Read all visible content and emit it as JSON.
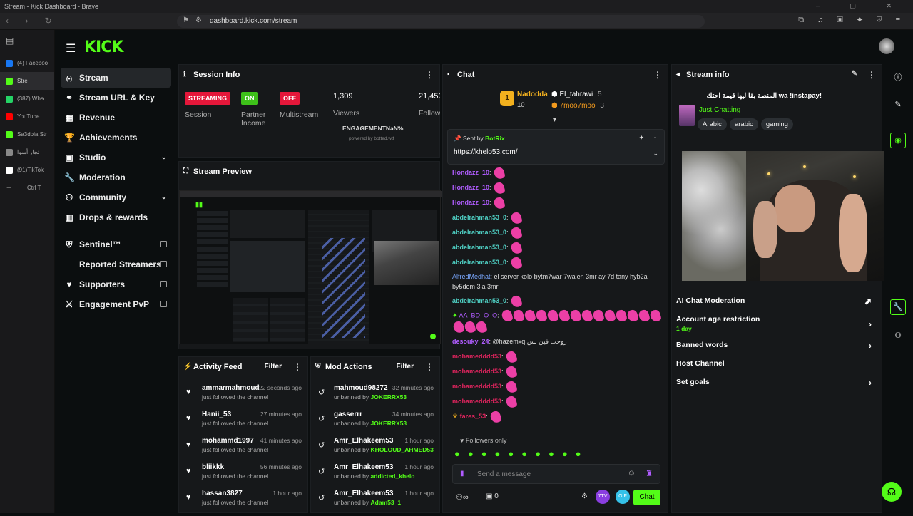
{
  "browser": {
    "window_title": "Stream - Kick Dashboard - Brave",
    "url": "dashboard.kick.com/stream",
    "tabs": [
      {
        "label": "(4) Faceboo",
        "color": "#1877f2"
      },
      {
        "label": "Stre",
        "color": "#53fc18"
      },
      {
        "label": "(387) Wha",
        "color": "#25d366"
      },
      {
        "label": "YouTube",
        "color": "#ff0000"
      },
      {
        "label": "Sa3dola Str",
        "color": "#53fc18"
      },
      {
        "label": "تجار أسوا",
        "color": "#888888"
      },
      {
        "label": "(91)TikTok",
        "color": "#ffffff"
      }
    ],
    "new_tab_shortcut": "Ctrl T"
  },
  "brand": {
    "logo": "KICK",
    "accent": "#53fc18"
  },
  "sidebar": {
    "items": [
      {
        "label": "Stream",
        "icon": "broadcast-icon"
      },
      {
        "label": "Stream URL & Key",
        "icon": "link-icon"
      },
      {
        "label": "Revenue",
        "icon": "revenue-icon"
      },
      {
        "label": "Achievements",
        "icon": "trophy-icon"
      },
      {
        "label": "Studio",
        "icon": "studio-icon"
      },
      {
        "label": "Moderation",
        "icon": "wrench-icon"
      },
      {
        "label": "Community",
        "icon": "people-icon"
      },
      {
        "label": "Drops & rewards",
        "icon": "gift-icon"
      }
    ],
    "external": [
      {
        "label": "Sentinel™"
      },
      {
        "label": "Reported Streamers"
      },
      {
        "label": "Supporters"
      },
      {
        "label": "Engagement PvP"
      }
    ]
  },
  "session_info": {
    "title": "Session Info",
    "stats": [
      {
        "badge": "STREAMING",
        "label": "Session"
      },
      {
        "badge": "ON",
        "label": "Partner Income"
      },
      {
        "badge": "OFF",
        "label": "Multistream"
      },
      {
        "value": "1,309",
        "label": "Viewers"
      },
      {
        "value": "21,450",
        "label": "Follow"
      }
    ],
    "engagement": "ENGAGEMENTNaN%",
    "powered": "powered by botted.wtf"
  },
  "stream_preview": {
    "title": "Stream Preview"
  },
  "activity_feed": {
    "title": "Activity Feed",
    "filter": "Filter",
    "items": [
      {
        "user": "ammarmahmoud",
        "time": "22 seconds ago",
        "text": "just followed the channel"
      },
      {
        "user": "Hanii_53",
        "time": "27 minutes ago",
        "text": "just followed the channel"
      },
      {
        "user": "mohammd1997",
        "time": "41 minutes ago",
        "text": "just followed the channel"
      },
      {
        "user": "bliikkk",
        "time": "56 minutes ago",
        "text": "just followed the channel"
      },
      {
        "user": "hassan3827",
        "time": "1 hour ago",
        "text": "just followed the channel"
      }
    ]
  },
  "mod_actions": {
    "title": "Mod Actions",
    "filter": "Filter",
    "items": [
      {
        "user": "mahmoud98272",
        "time": "32 minutes ago",
        "prefix": "unbanned by",
        "by": "JOKERRX53"
      },
      {
        "user": "gasserrr",
        "time": "34 minutes ago",
        "prefix": "unbanned by",
        "by": "JOKERRX53"
      },
      {
        "user": "Amr_Elhakeem53",
        "time": "1 hour ago",
        "prefix": "unbanned by",
        "by": "KHOLOUD_AHMED53"
      },
      {
        "user": "Amr_Elhakeem53",
        "time": "1 hour ago",
        "prefix": "unbanned by",
        "by": "addicted_khelo"
      },
      {
        "user": "Amr_Elhakeem53",
        "time": "1 hour ago",
        "prefix": "unbanned by",
        "by": "Adam53_1"
      }
    ]
  },
  "chat": {
    "title": "Chat",
    "leaderboard": [
      {
        "name": "Nadodda",
        "count": "10"
      },
      {
        "name": "El_tahrawi",
        "count": "5"
      },
      {
        "name": "7moo7moo",
        "count": "3"
      }
    ],
    "pinned": {
      "sent_by": "Sent by",
      "bot": "BotRix",
      "link": "https://khelo53.com/"
    },
    "messages": [
      {
        "user": "Hondazz_10",
        "color": "#b05cff",
        "text": "",
        "emotes": 1
      },
      {
        "user": "Hondazz_10",
        "color": "#b05cff",
        "text": "",
        "emotes": 1
      },
      {
        "user": "Hondazz_10",
        "color": "#b05cff",
        "text": "",
        "emotes": 1
      },
      {
        "user": "abdelrahman53_0",
        "color": "#4fd1c5",
        "text": "",
        "emotes": 1
      },
      {
        "user": "abdelrahman53_0",
        "color": "#4fd1c5",
        "text": "",
        "emotes": 1
      },
      {
        "user": "abdelrahman53_0",
        "color": "#4fd1c5",
        "text": "",
        "emotes": 1
      },
      {
        "user": "abdelrahman53_0",
        "color": "#4fd1c5",
        "text": "",
        "emotes": 1
      }
    ],
    "long_message": {
      "user": "AlfredMedhat",
      "color": "#7aa8ff",
      "text": "el server kolo bytm7war 7walen 3mr ay 7d tany hyb2a by5dem 3la 3mr"
    },
    "messages2": [
      {
        "user": "abdelrahman53_0",
        "color": "#4fd1c5",
        "text": "",
        "emotes": 1
      }
    ],
    "spam": {
      "user": "AA_BD_O_O",
      "color": "#b05cff"
    },
    "desouky": {
      "user": "desouky_24",
      "color": "#b05cff",
      "text": "@hazemxq روحت فين بس"
    },
    "messages3": [
      {
        "user": "mohamedddd53",
        "color": "#e0245e"
      },
      {
        "user": "mohamedddd53",
        "color": "#e0245e"
      },
      {
        "user": "mohamedddd53",
        "color": "#e0245e"
      },
      {
        "user": "mohamedddd53",
        "color": "#e0245e"
      },
      {
        "user": "fares_53",
        "color": "#e0245e"
      }
    ],
    "followers_only": "Followers only",
    "placeholder": "Send a message",
    "send_label": "Chat",
    "count": "0"
  },
  "stream_info": {
    "title": "Stream info",
    "stream_title": "!wa !instapay المنصة بقا ليها قيمة احتك",
    "category": "Just Chatting",
    "tags": [
      "Arabic",
      "arabic",
      "gaming"
    ]
  },
  "settings": {
    "ai_moderation": "AI Chat Moderation",
    "account_age": "Account age restriction",
    "account_age_value": "1 day",
    "banned_words": "Banned words",
    "host_channel": "Host Channel",
    "set_goals": "Set goals"
  }
}
